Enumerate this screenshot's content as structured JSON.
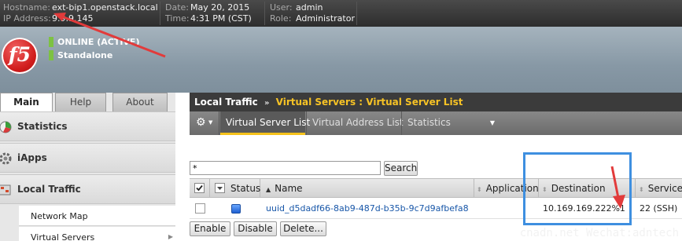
{
  "header": {
    "hostname_label": "Hostname:",
    "hostname_value": "ext-bip1.openstack.local",
    "ip_label": "IP Address:",
    "ip_value": "9.9.9.145",
    "date_label": "Date:",
    "date_value": "May 20, 2015",
    "time_label": "Time:",
    "time_value": "4:31 PM (CST)",
    "user_label": "User:",
    "user_value": "admin",
    "role_label": "Role:",
    "role_value": "Administrator"
  },
  "banner": {
    "logo_text": "f5",
    "status_online": "ONLINE (ACTIVE)",
    "status_mode": "Standalone",
    "status_color": "#7dc242"
  },
  "nav": {
    "tabs": [
      "Main",
      "Help",
      "About"
    ],
    "sections": [
      "Statistics",
      "iApps",
      "Local Traffic"
    ],
    "sub_items": [
      "Network Map",
      "Virtual Servers"
    ]
  },
  "page": {
    "section": "Local Traffic",
    "breadcrumb": "Virtual Servers : Virtual Server List",
    "accent_color": "#f5c21b"
  },
  "tabs": {
    "gear_icon": "gear-icon",
    "items": [
      "Virtual Server List",
      "Virtual Address List",
      "Statistics"
    ]
  },
  "search": {
    "value": "*",
    "button_label": "Search"
  },
  "table": {
    "columns": [
      "Status",
      "Name",
      "Application",
      "Destination",
      "Service P"
    ],
    "rows": [
      {
        "status_icon": "status-available-icon",
        "name": "uuid_d5dadf66-8ab9-487d-b35b-9c7d9afbefa8",
        "application": "",
        "destination": "10.169.169.222%1",
        "service_port": "22 (SSH)"
      }
    ]
  },
  "actions": [
    "Enable",
    "Disable",
    "Delete..."
  ],
  "watermark": "cnadn.net Wechat:adntech",
  "annotation_colors": {
    "arrow": "#e23b3b",
    "box": "#3e8fe0"
  }
}
